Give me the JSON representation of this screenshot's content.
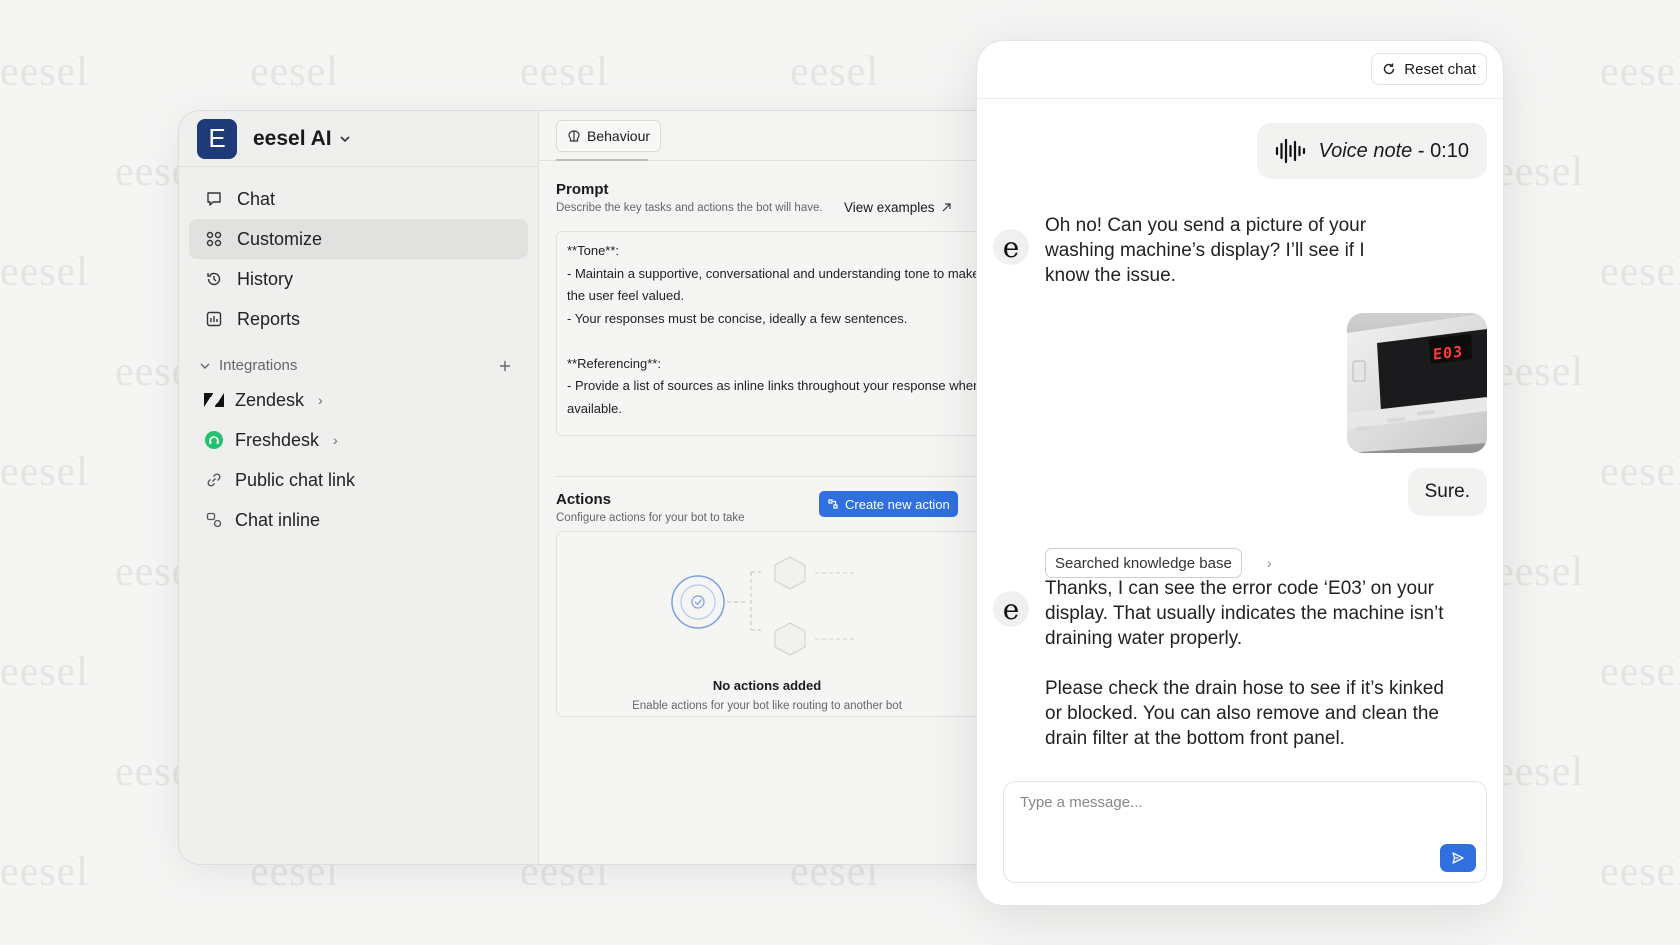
{
  "watermark": "eesel",
  "workspace": {
    "initial": "E",
    "name": "eesel AI"
  },
  "nav": [
    {
      "label": "Chat",
      "icon": "chat-bubble-icon",
      "active": false
    },
    {
      "label": "Customize",
      "icon": "customize-grid-icon",
      "active": true
    },
    {
      "label": "History",
      "icon": "history-icon",
      "active": false
    },
    {
      "label": "Reports",
      "icon": "reports-icon",
      "active": false
    }
  ],
  "integrations": {
    "header": "Integrations",
    "items": [
      {
        "label": "Zendesk",
        "icon": "zendesk-icon",
        "has_chevron": true
      },
      {
        "label": "Freshdesk",
        "icon": "freshdesk-icon",
        "has_chevron": true
      },
      {
        "label": "Public chat link",
        "icon": "link-icon",
        "has_chevron": false
      },
      {
        "label": "Chat inline",
        "icon": "chat-inline-icon",
        "has_chevron": false
      }
    ]
  },
  "tabs": {
    "behaviour": "Behaviour"
  },
  "prompt": {
    "title": "Prompt",
    "subtitle": "Describe the key tasks and actions the bot will have.",
    "view_examples": "View examples",
    "text": "**Tone**:\n- Maintain a supportive, conversational and understanding tone to make the user feel valued.\n- Your responses must be concise, ideally a few sentences.\n\n**Referencing**:\n- Provide a list of sources as inline links throughout your response where available."
  },
  "actions": {
    "title": "Actions",
    "subtitle": "Configure actions for your bot to take",
    "create_button": "Create new action",
    "empty_title": "No actions added",
    "empty_subtitle": "Enable actions for your bot like routing to another bot"
  },
  "chat": {
    "reset_label": "Reset chat",
    "voice_note": "Voice note",
    "voice_duration": "0:10",
    "bot_message_1": "Oh no! Can you send a picture of your washing machine’s display? I’ll see if I know the issue.",
    "display_code": "E03",
    "user_reply": "Sure.",
    "kb_chip": "Searched knowledge base",
    "bot_message_2": "Thanks, I can see the error code ‘E03’ on your display. That usually indicates the machine isn’t draining water properly.\n\nPlease check the drain hose to see if it’s kinked or blocked. You can also remove and clean the drain filter at the bottom front panel.",
    "input_placeholder": "Type a message..."
  },
  "colors": {
    "accent": "#2f6fde",
    "avatar_bg": "#1e3a78",
    "freshdesk": "#25c16f"
  }
}
